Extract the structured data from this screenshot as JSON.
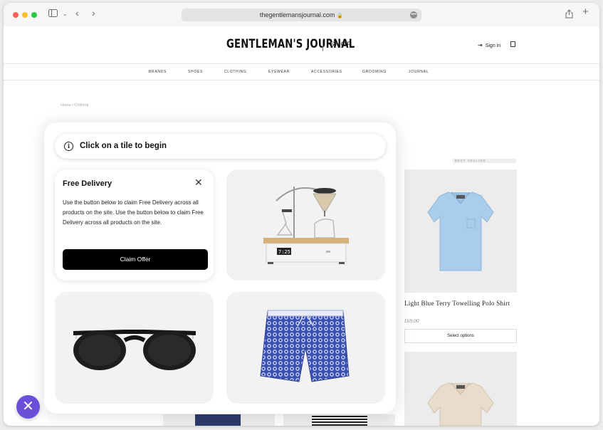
{
  "browser": {
    "url": "thegentlemansjournal.com"
  },
  "header": {
    "logo": "GENTLEMAN'S JOURNAL",
    "shop": "SHOP",
    "sign_in": "Sign in"
  },
  "nav": {
    "items": [
      "BRANDS",
      "SHOES",
      "CLOTHING",
      "EYEWEAR",
      "ACCESSORIES",
      "GROOMING",
      "JOURNAL"
    ]
  },
  "breadcrumb": "Home  /  Clothing",
  "best_selling": "BEST SELLING",
  "product": {
    "name": "Light Blue Terry Towelling Polo Shirt",
    "price": "£69.00",
    "button": "Select options"
  },
  "overlay": {
    "info_text": "Click on a tile to begin",
    "offer_title": "Free Delivery",
    "offer_body": "Use the button below to claim Free Delivery across all products on the site. Use the button below to claim Free Delivery across all products on the site.",
    "claim_button": "Claim Offer",
    "coffee_display": "7:25"
  },
  "colors": {
    "accent_purple": "#6a4fd9",
    "polo_blue": "#a9cdeb",
    "polo_beige": "#e8dccb",
    "shorts_blue": "#3a52b5"
  }
}
